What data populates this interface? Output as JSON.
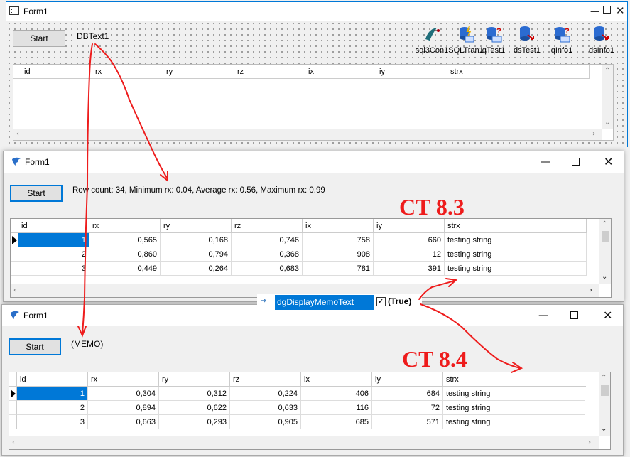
{
  "design_form": {
    "title": "Form1",
    "start_label": "Start",
    "dbtext_label": "DBText1",
    "components": [
      {
        "label": "sql3Con1",
        "icon": "sqlite-connection-icon"
      },
      {
        "label": "SQLTran1",
        "icon": "sql-transaction-icon"
      },
      {
        "label": "qTest1",
        "icon": "sql-query-icon"
      },
      {
        "label": "dsTest1",
        "icon": "datasource-icon"
      },
      {
        "label": "qInfo1",
        "icon": "sql-query-icon"
      },
      {
        "label": "dsInfo1",
        "icon": "datasource-icon"
      }
    ],
    "columns": [
      "id",
      "rx",
      "ry",
      "rz",
      "ix",
      "iy",
      "strx"
    ]
  },
  "form_83": {
    "title": "Form1",
    "start_label": "Start",
    "info_text": "Row count: 34, Minimum rx: 0.04, Average rx: 0.56, Maximum rx: 0.99",
    "columns": [
      "id",
      "rx",
      "ry",
      "rz",
      "ix",
      "iy",
      "strx"
    ],
    "rows": [
      {
        "id": "1",
        "rx": "0,565",
        "ry": "0,168",
        "rz": "0,746",
        "ix": "758",
        "iy": "660",
        "strx": "testing string"
      },
      {
        "id": "2",
        "rx": "0,860",
        "ry": "0,794",
        "rz": "0,368",
        "ix": "908",
        "iy": "12",
        "strx": "testing string"
      },
      {
        "id": "3",
        "rx": "0,449",
        "ry": "0,264",
        "rz": "0,683",
        "ix": "781",
        "iy": "391",
        "strx": "testing string"
      }
    ]
  },
  "form_84": {
    "title": "Form1",
    "start_label": "Start",
    "info_text": "(MEMO)",
    "columns": [
      "id",
      "rx",
      "ry",
      "rz",
      "ix",
      "iy",
      "strx"
    ],
    "rows": [
      {
        "id": "1",
        "rx": "0,304",
        "ry": "0,312",
        "rz": "0,224",
        "ix": "406",
        "iy": "684",
        "strx": "testing string"
      },
      {
        "id": "2",
        "rx": "0,894",
        "ry": "0,622",
        "rz": "0,633",
        "ix": "116",
        "iy": "72",
        "strx": "testing string"
      },
      {
        "id": "3",
        "rx": "0,663",
        "ry": "0,293",
        "rz": "0,905",
        "ix": "685",
        "iy": "571",
        "strx": "testing string"
      }
    ]
  },
  "inspector": {
    "property": "dgDisplayMemoText",
    "value": "(True)"
  },
  "annotations": {
    "ct83": "CT 8.3",
    "ct84": "CT 8.4",
    "color": "#ee1c1c"
  }
}
